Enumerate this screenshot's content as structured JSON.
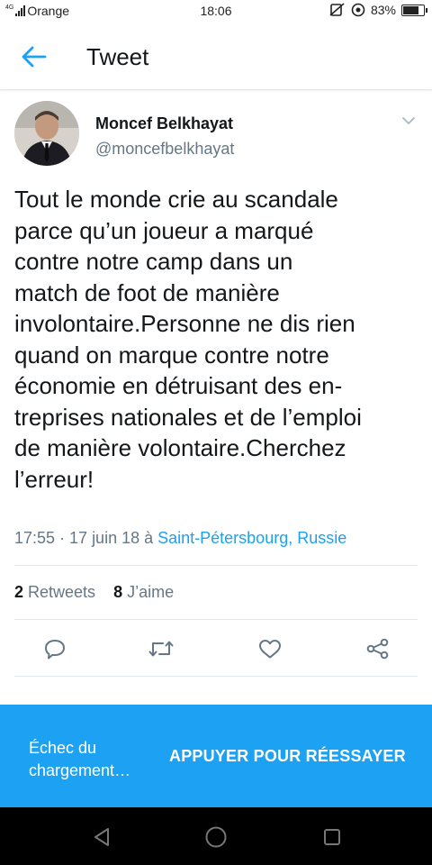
{
  "status_bar": {
    "network": "4G",
    "carrier": "Orange",
    "time": "18:06",
    "battery_percent_label": "83%",
    "battery_level": 0.83
  },
  "header": {
    "title": "Tweet",
    "back_icon": "arrow-left-icon"
  },
  "tweet": {
    "author": {
      "display_name": "Moncef Belkhayat",
      "handle": "@moncefbelkhayat"
    },
    "text": "Tout le monde crie au scandale\nparce qu’un joueur a marqué\ncontre notre camp dans un\nmatch de foot de manière\ninvolontaire.Personne ne dis rien\nquand on marque contre notre\néconomie  en détruisant des en-\ntreprises nationales et de l’emploi\nde manière volontaire.Cherchez\nl’erreur!",
    "timestamp": "17:55 · 17 juin 18 à ",
    "location": "Saint-Pétersbourg, Russie",
    "stats": {
      "retweets_count": "2",
      "retweets_label": " Retweets",
      "likes_count": "8",
      "likes_label": " J’aime"
    },
    "actions": [
      "reply-icon",
      "retweet-icon",
      "like-icon",
      "share-icon"
    ]
  },
  "banner": {
    "message": "Échec du\nchargement…",
    "retry_label": "APPUYER POUR RÉESSAYER"
  },
  "nav_bar": {
    "buttons": [
      "back-triangle-icon",
      "home-circle-icon",
      "recents-square-icon"
    ]
  },
  "colors": {
    "accent": "#1da1f2",
    "text_primary": "#14171a",
    "text_secondary": "#657786",
    "divider": "#e1e8ed"
  }
}
